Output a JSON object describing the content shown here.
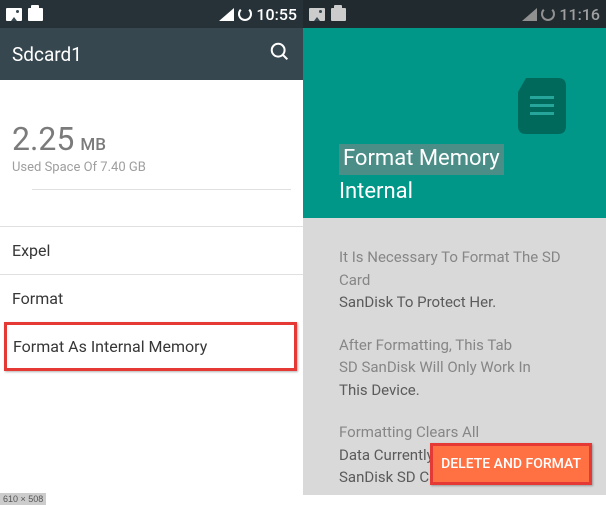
{
  "left": {
    "status_time": "10:55",
    "appbar_title": "Sdcard1",
    "size_value": "2.25",
    "size_unit": "MB",
    "size_sub": "Used Space Of 7.40 GB",
    "item_expel": "Expel",
    "item_format": "Format",
    "item_format_internal": "Format As Internal Memory"
  },
  "right": {
    "status_time": "11:16",
    "header_line1": "Format Memory",
    "header_line2": "Internal",
    "p1a": "It Is Necessary To Format The SD Card",
    "p1b": "SanDisk To Protect Her.",
    "p2a": "After Formatting, This Tab",
    "p2b": "SD SanDisk Will Only Work In",
    "p2c": "This Device.",
    "p3a": "Formatting Clears All",
    "p3b": "Data Currently Stored On The",
    "p3c": "SanDisk SD Card. To Avoid",
    "button": "DELETE AND FORMAT"
  },
  "dim_label": "610 × 508"
}
